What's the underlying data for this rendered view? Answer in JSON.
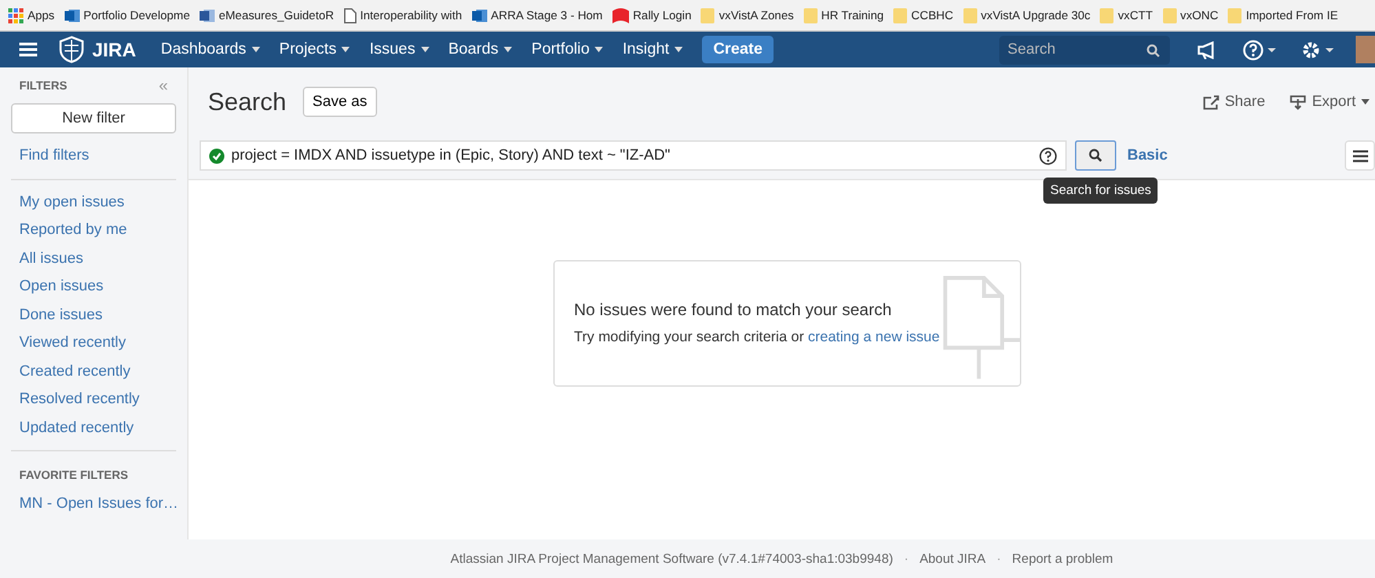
{
  "bookmarks": [
    {
      "label": "Apps",
      "kind": "apps"
    },
    {
      "label": "Portfolio Developme",
      "kind": "sharepoint"
    },
    {
      "label": "eMeasures_GuidetoR",
      "kind": "word"
    },
    {
      "label": "Interoperability with",
      "kind": "page"
    },
    {
      "label": "ARRA Stage 3 - Hom",
      "kind": "sharepoint"
    },
    {
      "label": "Rally Login",
      "kind": "rally"
    },
    {
      "label": "vxVistA Zones",
      "kind": "folder"
    },
    {
      "label": "HR Training",
      "kind": "folder"
    },
    {
      "label": "CCBHC",
      "kind": "folder"
    },
    {
      "label": "vxVistA Upgrade 30c",
      "kind": "folder"
    },
    {
      "label": "vxCTT",
      "kind": "folder"
    },
    {
      "label": "vxONC",
      "kind": "folder"
    },
    {
      "label": "Imported From IE",
      "kind": "folder"
    }
  ],
  "nav": {
    "logo": "JIRA",
    "menus": [
      "Dashboards",
      "Projects",
      "Issues",
      "Boards",
      "Portfolio",
      "Insight"
    ],
    "create": "Create",
    "search": {
      "placeholder": "Search"
    }
  },
  "sidebar": {
    "title": "FILTERS",
    "collapse": "«",
    "new_filter": "New filter",
    "find_filters": "Find filters",
    "items": [
      "My open issues",
      "Reported by me",
      "All issues",
      "Open issues",
      "Done issues",
      "Viewed recently",
      "Created recently",
      "Resolved recently",
      "Updated recently"
    ],
    "favorites_title": "FAVORITE FILTERS",
    "favorites": [
      "MN - Open Issues for…"
    ]
  },
  "header": {
    "title": "Search",
    "save_as": "Save as",
    "share": "Share",
    "export": "Export"
  },
  "query": {
    "value": "project = IMDX AND issuetype in (Epic, Story) AND text ~ \"IZ-AD\"",
    "valid": true,
    "mode": "Basic",
    "tooltip": "Search for issues"
  },
  "empty": {
    "title": "No issues were found to match your search",
    "text": "Try modifying your search criteria or",
    "link": "creating a new issue"
  },
  "footer": {
    "items": [
      "Atlassian JIRA Project Management Software (v7.4.1#74003-sha1:03b9948)",
      "About JIRA",
      "Report a problem"
    ],
    "separator": "·"
  }
}
